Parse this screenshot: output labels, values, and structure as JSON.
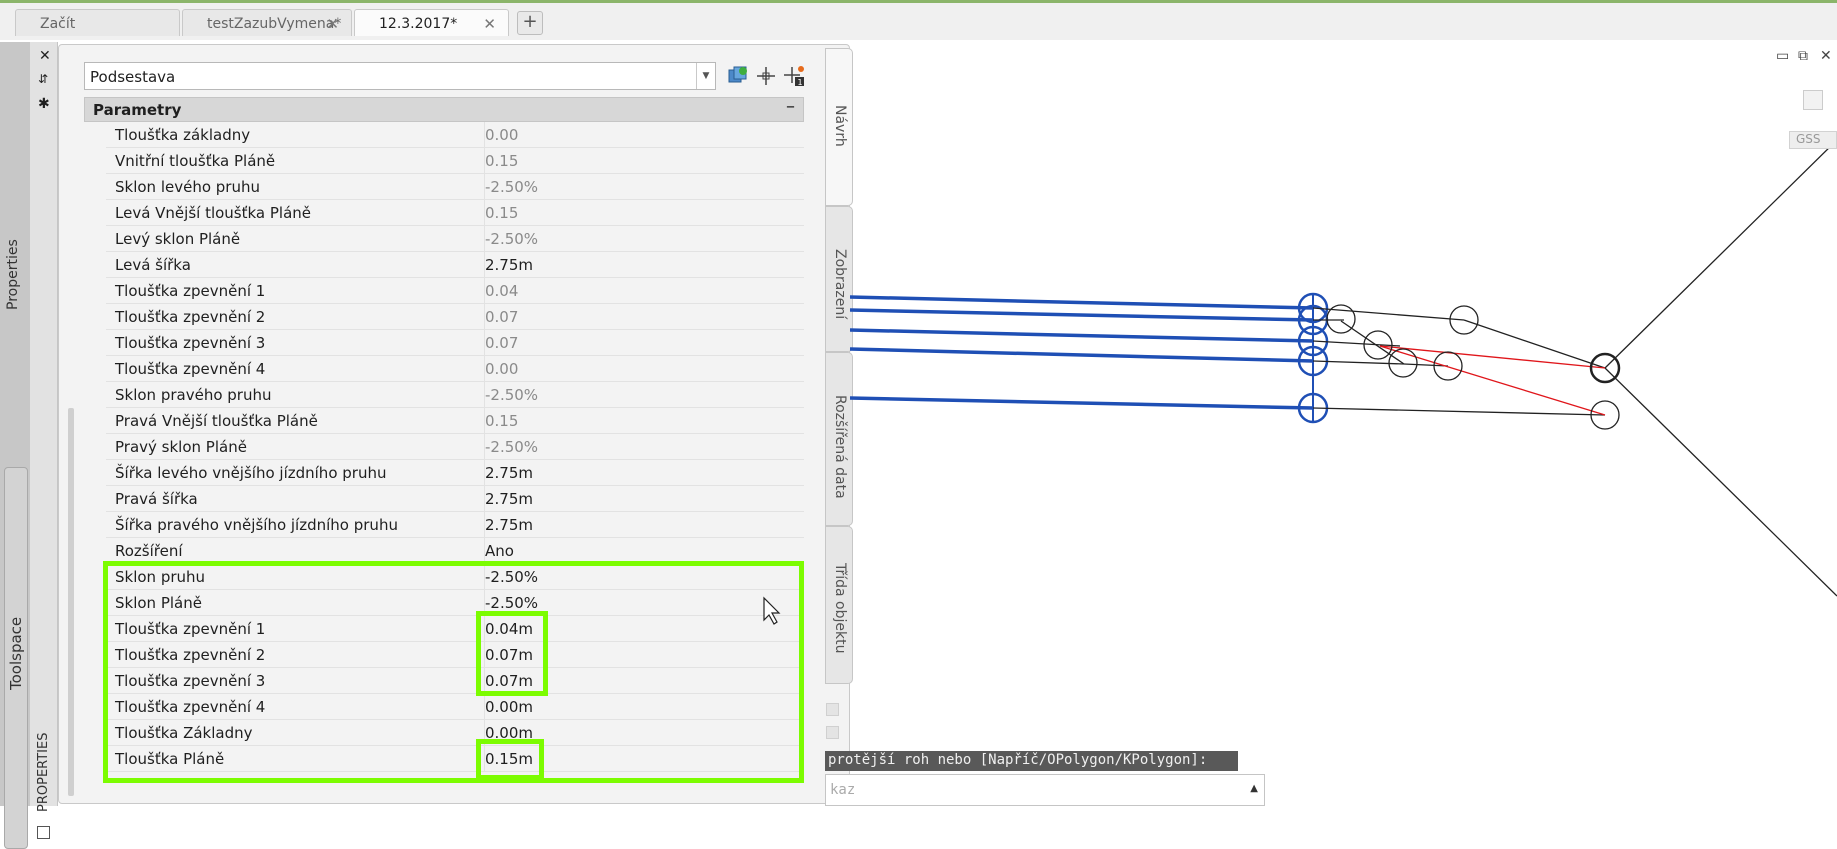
{
  "tabs": [
    {
      "label": "Začít",
      "closable": false
    },
    {
      "label": "testZazubVymena*",
      "closable": true
    },
    {
      "label": "12.3.2017*",
      "closable": true,
      "active": true
    }
  ],
  "left_strip": {
    "properties_label": "Properties",
    "toolspace_label": "Toolspace",
    "palette_label": "PROPERTIES"
  },
  "panel": {
    "combo_value": "Podsestava",
    "section_title": "Parametry",
    "section_collapse": "–",
    "rows": [
      {
        "label": "Tloušťka základny",
        "value": "0.00",
        "dim": true
      },
      {
        "label": "Vnitřní tloušťka Pláně",
        "value": "0.15",
        "dim": true
      },
      {
        "label": "Sklon levého pruhu",
        "value": "-2.50%",
        "dim": true
      },
      {
        "label": "Levá Vnější tloušťka Pláně",
        "value": "0.15",
        "dim": true
      },
      {
        "label": "Levý sklon Pláně",
        "value": "-2.50%",
        "dim": true
      },
      {
        "label": "Levá šířka",
        "value": "2.75m",
        "dim": false
      },
      {
        "label": "Tloušťka zpevnění 1",
        "value": "0.04",
        "dim": true
      },
      {
        "label": "Tloušťka zpevnění 2",
        "value": "0.07",
        "dim": true
      },
      {
        "label": "Tloušťka zpevnění 3",
        "value": "0.07",
        "dim": true
      },
      {
        "label": "Tloušťka zpevnění 4",
        "value": "0.00",
        "dim": true
      },
      {
        "label": "Sklon pravého pruhu",
        "value": "-2.50%",
        "dim": true
      },
      {
        "label": "Pravá Vnější tloušťka Pláně",
        "value": "0.15",
        "dim": true
      },
      {
        "label": "Pravý sklon Pláně",
        "value": "-2.50%",
        "dim": true
      },
      {
        "label": "Šířka levého vnějšího jízdního pruhu",
        "value": "2.75m",
        "dim": false
      },
      {
        "label": "Pravá šířka",
        "value": "2.75m",
        "dim": false
      },
      {
        "label": "Šířka pravého vnějšího jízdního pruhu",
        "value": "2.75m",
        "dim": false
      },
      {
        "label": "Rozšíření",
        "value": "Ano",
        "dim": false
      },
      {
        "label": "Sklon pruhu",
        "value": "-2.50%",
        "dim": false
      },
      {
        "label": "Sklon Pláně",
        "value": "-2.50%",
        "dim": false
      },
      {
        "label": "Tloušťka zpevnění 1",
        "value": "0.04m",
        "dim": false
      },
      {
        "label": "Tloušťka zpevnění 2",
        "value": "0.07m",
        "dim": false
      },
      {
        "label": "Tloušťka zpevnění 3",
        "value": "0.07m",
        "dim": false
      },
      {
        "label": "Tloušťka zpevnění 4",
        "value": "0.00m",
        "dim": false
      },
      {
        "label": "Tloušťka Základny",
        "value": "0.00m",
        "dim": false
      },
      {
        "label": "Tloušťka Pláně",
        "value": "0.15m",
        "dim": false
      }
    ]
  },
  "right_tabs": [
    "Návrh",
    "Zobrazení",
    "Rozšířená data",
    "Třída objektu"
  ],
  "command": {
    "prompt": "protější roh nebo [Napříč/OPolygon/KPolygon]:",
    "placeholder": "kaz"
  },
  "viewport": {
    "gss_label": "GSS"
  },
  "colors": {
    "highlight": "#7cfc00",
    "selected_blue": "#1f4fb5",
    "red_line": "#e0161b"
  },
  "icons": [
    "close-icon",
    "pin-icon",
    "settings-icon",
    "quick-select-icon",
    "select-objects-icon",
    "pickadd-icon",
    "cursor-arrow-icon"
  ]
}
